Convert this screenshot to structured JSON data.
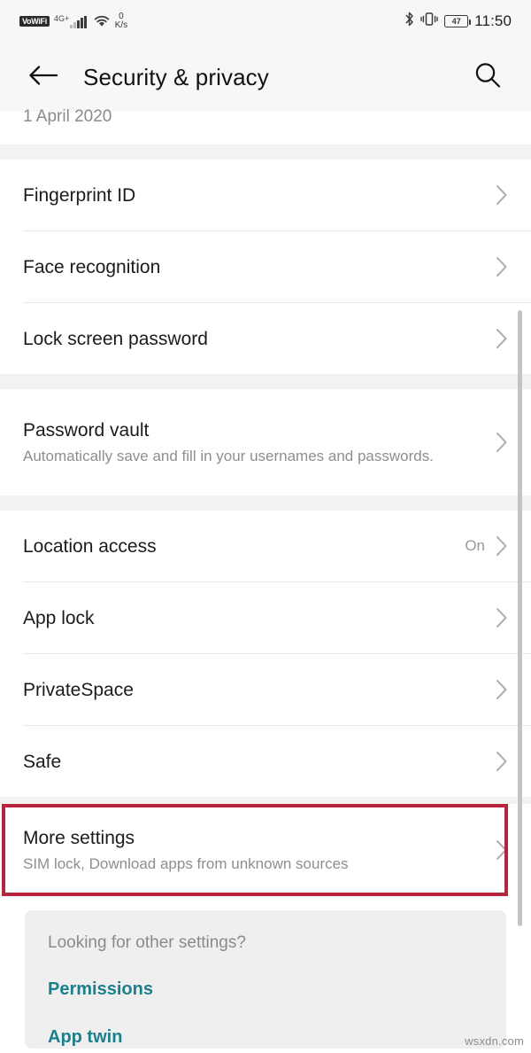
{
  "status_bar": {
    "vowifi_label": "VoWiFi",
    "network_label": "4G",
    "network_plus": "+",
    "data_rate_value": "0",
    "data_rate_unit": "K/s",
    "bluetooth_icon": "bluetooth-icon",
    "vibrate_icon": "vibrate-icon",
    "battery_level": "47",
    "time": "11:50"
  },
  "header": {
    "back_icon": "back-arrow-icon",
    "title": "Security & privacy",
    "search_icon": "search-icon"
  },
  "partial_row": {
    "label": "1 April 2020"
  },
  "groups": [
    {
      "rows": [
        {
          "label": "Fingerprint ID",
          "subtitle": "",
          "value": ""
        },
        {
          "label": "Face recognition",
          "subtitle": "",
          "value": ""
        },
        {
          "label": "Lock screen password",
          "subtitle": "",
          "value": ""
        }
      ]
    },
    {
      "rows": [
        {
          "label": "Password vault",
          "subtitle": "Automatically save and fill in your usernames and passwords.",
          "value": ""
        }
      ]
    },
    {
      "rows": [
        {
          "label": "Location access",
          "subtitle": "",
          "value": "On"
        },
        {
          "label": "App lock",
          "subtitle": "",
          "value": ""
        },
        {
          "label": "PrivateSpace",
          "subtitle": "",
          "value": ""
        },
        {
          "label": "Safe",
          "subtitle": "",
          "value": ""
        }
      ]
    },
    {
      "highlighted": true,
      "rows": [
        {
          "label": "More settings",
          "subtitle": "SIM lock, Download apps from unknown sources",
          "value": ""
        }
      ]
    }
  ],
  "footer_card": {
    "question": "Looking for other settings?",
    "links": [
      {
        "label": "Permissions"
      },
      {
        "label": "App twin"
      }
    ]
  },
  "watermark": "wsxdn.com",
  "colors": {
    "highlight_border": "#b5243c",
    "link_teal": "#1b7f8c",
    "status_bg": "#f7f7f7",
    "gap_grey": "#f2f2f2",
    "card_grey": "#efefef",
    "divider": "#e8e8e8"
  }
}
